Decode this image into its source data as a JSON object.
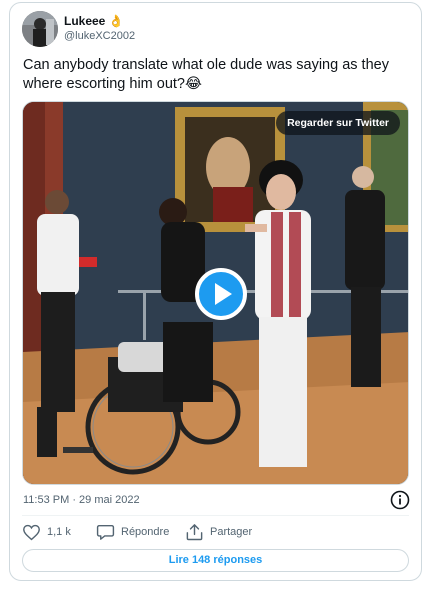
{
  "author": {
    "display_name": "Lukeee",
    "badge_emoji": "👌",
    "handle": "@lukeXC2002"
  },
  "tweet": {
    "text": "Can anybody translate what ole dude was saying as they where escorting him out?😂"
  },
  "media": {
    "watch_label": "Regarder sur Twitter",
    "play_icon": "play-icon"
  },
  "meta": {
    "timestamp": "11:53 PM · 29 mai 2022"
  },
  "actions": {
    "likes_count": "1,1 k",
    "reply_label": "Répondre",
    "share_label": "Partager"
  },
  "replies": {
    "label": "Lire 148 réponses"
  },
  "colors": {
    "accent": "#1d9bf0",
    "text": "#0f1419",
    "secondary": "#536471",
    "border": "#cfd9de"
  }
}
